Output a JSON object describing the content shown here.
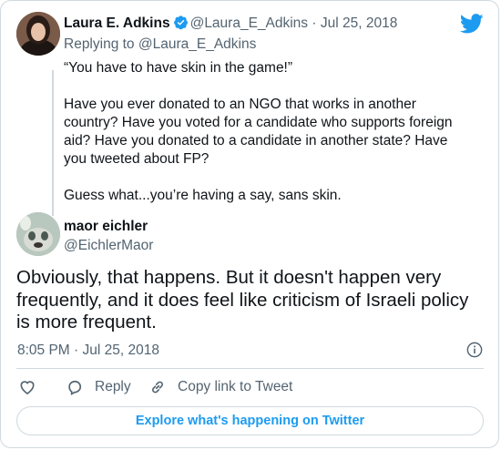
{
  "parent_tweet": {
    "author_name": "Laura E. Adkins",
    "author_handle": "@Laura_E_Adkins",
    "separator": "·",
    "date": "Jul 25, 2018",
    "replying_prefix": "Replying to",
    "replying_to": "@Laura_E_Adkins",
    "paragraphs": [
      "“You have to have skin in the game!”",
      "Have you ever donated to an NGO that works in another country? Have you voted for a candidate who supports foreign aid? Have you donated to a candidate in another state? Have you tweeted about FP?",
      "Guess what...you’re having a say, sans skin."
    ]
  },
  "main_tweet": {
    "author_name": "maor eichler",
    "author_handle": "@EichlerMaor",
    "text": "Obviously, that happens. But it doesn't happen very frequently, and it does feel like criticism of Israeli policy is more frequent.",
    "timestamp": "8:05 PM · Jul 25, 2018"
  },
  "actions": {
    "reply_label": "Reply",
    "copy_label": "Copy link to Tweet"
  },
  "explore_label": "Explore what's happening on Twitter",
  "colors": {
    "accent": "#1d9bf0",
    "muted": "#536471",
    "border": "#cfd9de"
  },
  "icons": [
    "twitter-bird-icon",
    "verified-badge-icon",
    "info-icon",
    "heart-icon",
    "reply-icon",
    "link-icon"
  ]
}
